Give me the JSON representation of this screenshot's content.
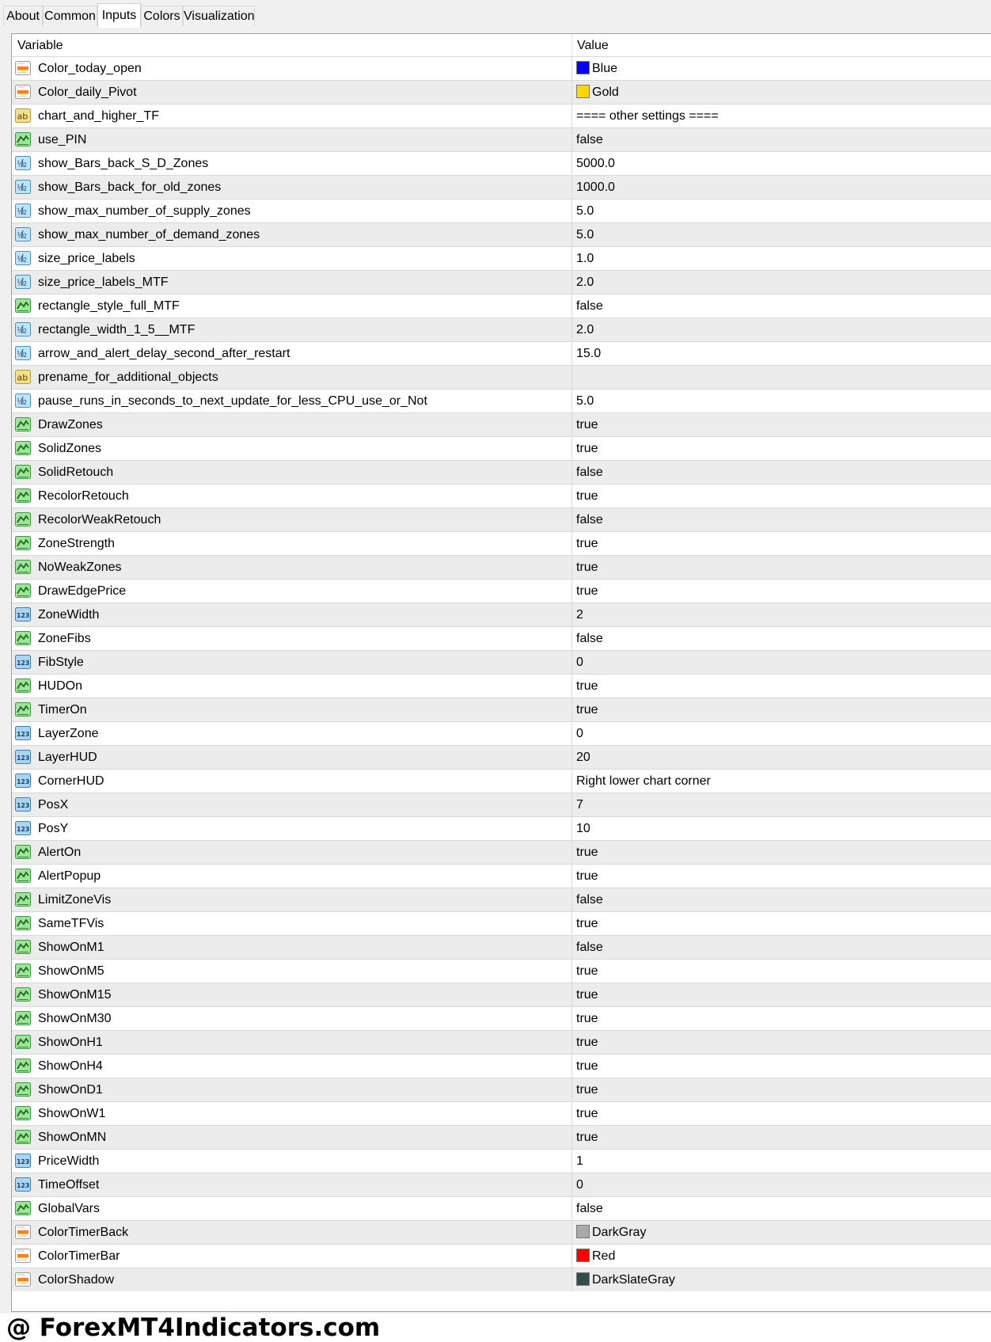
{
  "tabs": [
    {
      "label": "About",
      "active": false
    },
    {
      "label": "Common",
      "active": false
    },
    {
      "label": "Inputs",
      "active": true
    },
    {
      "label": "Colors",
      "active": false
    },
    {
      "label": "Visualization",
      "active": false
    }
  ],
  "table": {
    "columns": [
      "Variable",
      "Value"
    ],
    "rows": [
      {
        "icon": "color",
        "name": "Color_today_open",
        "value": "Blue",
        "swatch": "#0000ff"
      },
      {
        "icon": "color",
        "name": "Color_daily_Pivot",
        "value": "Gold",
        "swatch": "#ffd700"
      },
      {
        "icon": "string",
        "name": "chart_and_higher_TF",
        "value": "==== other settings ===="
      },
      {
        "icon": "bool",
        "name": "use_PIN",
        "value": "false"
      },
      {
        "icon": "double",
        "name": "show_Bars_back_S_D_Zones",
        "value": "5000.0"
      },
      {
        "icon": "double",
        "name": "show_Bars_back_for_old_zones",
        "value": "1000.0"
      },
      {
        "icon": "double",
        "name": "show_max_number_of_supply_zones",
        "value": "5.0"
      },
      {
        "icon": "double",
        "name": "show_max_number_of_demand_zones",
        "value": "5.0"
      },
      {
        "icon": "double",
        "name": "size_price_labels",
        "value": "1.0"
      },
      {
        "icon": "double",
        "name": "size_price_labels_MTF",
        "value": "2.0"
      },
      {
        "icon": "bool",
        "name": "rectangle_style_full_MTF",
        "value": "false"
      },
      {
        "icon": "double",
        "name": "rectangle_width_1_5__MTF",
        "value": "2.0"
      },
      {
        "icon": "double",
        "name": "arrow_and_alert_delay_second_after_restart",
        "value": "15.0"
      },
      {
        "icon": "string",
        "name": "prename_for_additional_objects",
        "value": ""
      },
      {
        "icon": "double",
        "name": "pause_runs_in_seconds_to_next_update_for_less_CPU_use_or_Not",
        "value": "5.0"
      },
      {
        "icon": "bool",
        "name": "DrawZones",
        "value": "true"
      },
      {
        "icon": "bool",
        "name": "SolidZones",
        "value": "true"
      },
      {
        "icon": "bool",
        "name": "SolidRetouch",
        "value": "false"
      },
      {
        "icon": "bool",
        "name": "RecolorRetouch",
        "value": "true"
      },
      {
        "icon": "bool",
        "name": "RecolorWeakRetouch",
        "value": "false"
      },
      {
        "icon": "bool",
        "name": "ZoneStrength",
        "value": "true"
      },
      {
        "icon": "bool",
        "name": "NoWeakZones",
        "value": "true"
      },
      {
        "icon": "bool",
        "name": "DrawEdgePrice",
        "value": "true"
      },
      {
        "icon": "int",
        "name": "ZoneWidth",
        "value": "2"
      },
      {
        "icon": "bool",
        "name": "ZoneFibs",
        "value": "false"
      },
      {
        "icon": "int",
        "name": "FibStyle",
        "value": "0"
      },
      {
        "icon": "bool",
        "name": "HUDOn",
        "value": "true"
      },
      {
        "icon": "bool",
        "name": "TimerOn",
        "value": "true"
      },
      {
        "icon": "int",
        "name": "LayerZone",
        "value": "0"
      },
      {
        "icon": "int",
        "name": "LayerHUD",
        "value": "20"
      },
      {
        "icon": "int",
        "name": "CornerHUD",
        "value": "Right lower chart corner"
      },
      {
        "icon": "int",
        "name": "PosX",
        "value": "7"
      },
      {
        "icon": "int",
        "name": "PosY",
        "value": "10"
      },
      {
        "icon": "bool",
        "name": "AlertOn",
        "value": "true"
      },
      {
        "icon": "bool",
        "name": "AlertPopup",
        "value": "true"
      },
      {
        "icon": "bool",
        "name": "LimitZoneVis",
        "value": "false"
      },
      {
        "icon": "bool",
        "name": "SameTFVis",
        "value": "true"
      },
      {
        "icon": "bool",
        "name": "ShowOnM1",
        "value": "false"
      },
      {
        "icon": "bool",
        "name": "ShowOnM5",
        "value": "true"
      },
      {
        "icon": "bool",
        "name": "ShowOnM15",
        "value": "true"
      },
      {
        "icon": "bool",
        "name": "ShowOnM30",
        "value": "true"
      },
      {
        "icon": "bool",
        "name": "ShowOnH1",
        "value": "true"
      },
      {
        "icon": "bool",
        "name": "ShowOnH4",
        "value": "true"
      },
      {
        "icon": "bool",
        "name": "ShowOnD1",
        "value": "true"
      },
      {
        "icon": "bool",
        "name": "ShowOnW1",
        "value": "true"
      },
      {
        "icon": "bool",
        "name": "ShowOnMN",
        "value": "true"
      },
      {
        "icon": "int",
        "name": "PriceWidth",
        "value": "1"
      },
      {
        "icon": "int",
        "name": "TimeOffset",
        "value": "0"
      },
      {
        "icon": "bool",
        "name": "GlobalVars",
        "value": "false"
      },
      {
        "icon": "color",
        "name": "ColorTimerBack",
        "value": "DarkGray",
        "swatch": "#a9a9a9"
      },
      {
        "icon": "color",
        "name": "ColorTimerBar",
        "value": "Red",
        "swatch": "#ff0000"
      },
      {
        "icon": "color",
        "name": "ColorShadow",
        "value": "DarkSlateGray",
        "swatch": "#2f4f4f"
      }
    ]
  },
  "footer": {
    "watermark": "@ ForexMT4Indicators.com"
  }
}
